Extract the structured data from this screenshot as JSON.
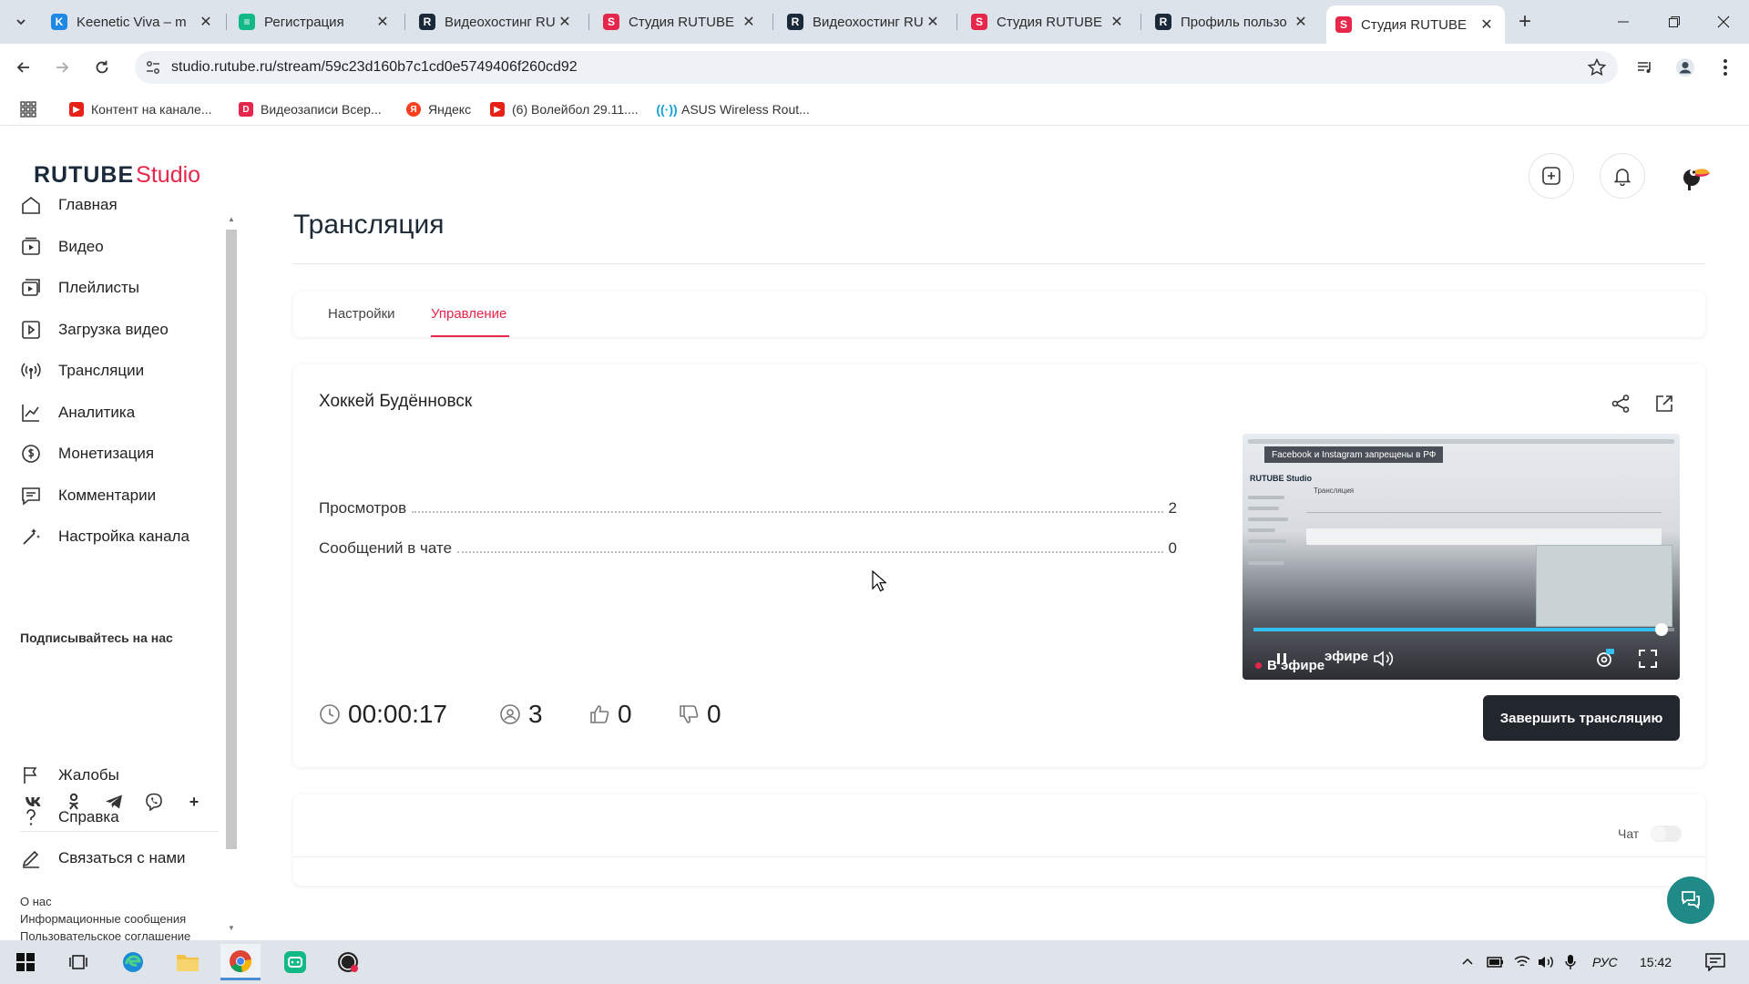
{
  "browser": {
    "tabs": [
      {
        "label": "Keenetic Viva – m",
        "favicon_color": "#1e88e5",
        "favicon_letter": "K"
      },
      {
        "label": "Регистрация",
        "favicon_color": "#12b886",
        "favicon_letter": "≡"
      },
      {
        "label": "Видеохостинг RU",
        "favicon_color": "#1b2a3a",
        "favicon_letter": "R"
      },
      {
        "label": "Студия RUTUBE",
        "favicon_color": "#e6264a",
        "favicon_letter": "S"
      },
      {
        "label": "Видеохостинг RU",
        "favicon_color": "#1b2a3a",
        "favicon_letter": "R"
      },
      {
        "label": "Студия RUTUBE",
        "favicon_color": "#e6264a",
        "favicon_letter": "S"
      },
      {
        "label": "Профиль пользо",
        "favicon_color": "#1b2a3a",
        "favicon_letter": "R"
      },
      {
        "label": "Студия RUTUBE",
        "favicon_color": "#e6264a",
        "favicon_letter": "S"
      }
    ],
    "url": "studio.rutube.ru/stream/59c23d160b7c1cd0e5749406f260cd92",
    "bookmarks": [
      {
        "label": "Контент на канале...",
        "color": "#e62117"
      },
      {
        "label": "Видеозаписи Всер...",
        "color": "#e6264a"
      },
      {
        "label": "Яндекс",
        "color": "#fc3f1d"
      },
      {
        "label": "(6) Волейбол 29.11....",
        "color": "#e62117"
      },
      {
        "label": "ASUS Wireless Rout...",
        "color": "#1a9fd6"
      }
    ]
  },
  "app": {
    "logo_main": "RUTUBE",
    "logo_studio": "Studio",
    "sidebar": {
      "items": [
        {
          "label": "Главная",
          "icon": "home-icon"
        },
        {
          "label": "Видео",
          "icon": "video-icon"
        },
        {
          "label": "Плейлисты",
          "icon": "playlist-icon"
        },
        {
          "label": "Загрузка видео",
          "icon": "upload-icon"
        },
        {
          "label": "Трансляции",
          "icon": "broadcast-icon"
        },
        {
          "label": "Аналитика",
          "icon": "analytics-icon"
        },
        {
          "label": "Монетизация",
          "icon": "monetization-icon"
        },
        {
          "label": "Комментарии",
          "icon": "comments-icon"
        },
        {
          "label": "Настройка канала",
          "icon": "channel-settings-icon"
        }
      ],
      "follow_label": "Подписывайтесь на нас",
      "socials": [
        "VK",
        "OK",
        "Telegram",
        "Viber",
        "+"
      ],
      "bottom_items": [
        {
          "label": "Жалобы",
          "icon": "flag-icon"
        },
        {
          "label": "Справка",
          "icon": "help-icon"
        },
        {
          "label": "Связаться с нами",
          "icon": "contact-icon"
        }
      ],
      "footer_links": [
        "О нас",
        "Информационные сообщения",
        "Пользовательское соглашение"
      ]
    },
    "page_title": "Трансляция",
    "tabs": [
      {
        "label": "Настройки",
        "active": false
      },
      {
        "label": "Управление",
        "active": true
      }
    ],
    "stream": {
      "name": "Хоккей Будённовск",
      "stats": [
        {
          "label": "Просмотров",
          "value": "2"
        },
        {
          "label": "Сообщений в чате",
          "value": "0"
        }
      ],
      "duration": "00:00:17",
      "viewers": "3",
      "likes": "0",
      "dislikes": "0",
      "end_button": "Завершить трансляцию"
    },
    "player": {
      "banner": "Facebook и Instagram запрещены в РФ",
      "live_label": "В эфире",
      "live_echo": "эфире",
      "mini_logo": "RUTUBE Studio",
      "mini_title": "Трансляция",
      "progress": 0.97
    },
    "chat": {
      "label": "Чат",
      "enabled": false
    }
  },
  "taskbar": {
    "language": "РУС",
    "time": "15:42"
  },
  "colors": {
    "accent": "#e6264a",
    "button_dark": "#22272e",
    "fab": "#1f8a86"
  }
}
